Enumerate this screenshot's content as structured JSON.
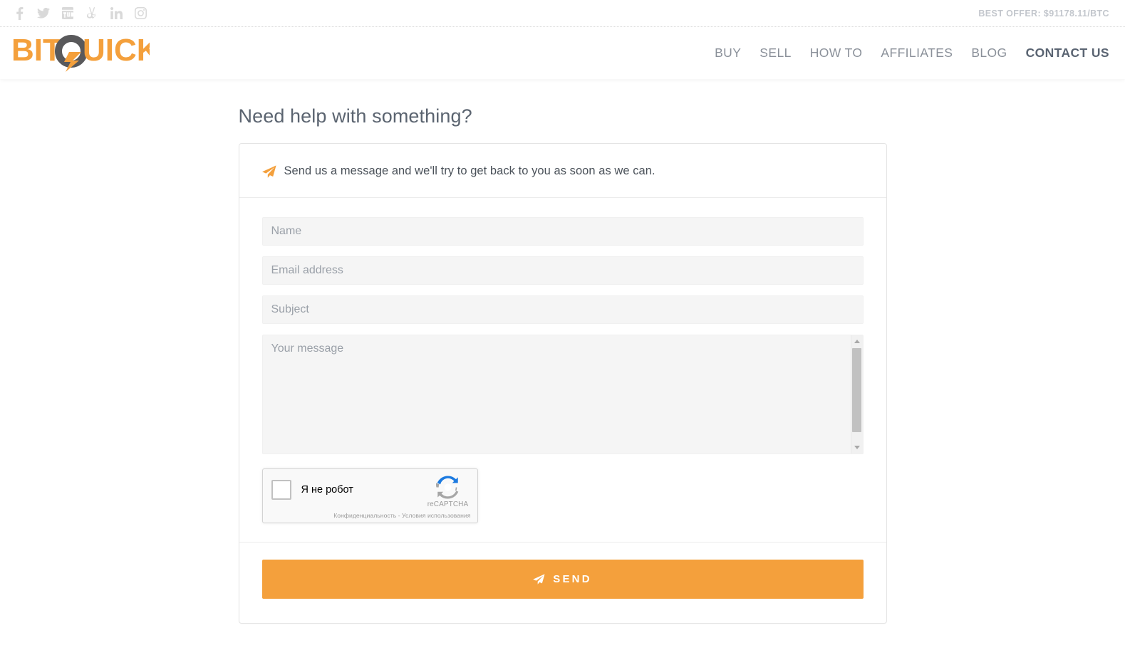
{
  "topbar": {
    "best_offer": "BEST OFFER: $91178.11/BTC",
    "social": [
      {
        "name": "facebook-icon",
        "label": "Facebook"
      },
      {
        "name": "twitter-icon",
        "label": "Twitter"
      },
      {
        "name": "youtube-icon",
        "label": "YouTube"
      },
      {
        "name": "angellist-icon",
        "label": "AngelList"
      },
      {
        "name": "linkedin-icon",
        "label": "LinkedIn"
      },
      {
        "name": "instagram-icon",
        "label": "Instagram"
      }
    ]
  },
  "header": {
    "logo_text_1": "BIT",
    "logo_text_2": "UICK",
    "logo_letter_q": "Q",
    "logo_alt": "BitQuick",
    "nav": [
      {
        "label": "BUY",
        "active": false
      },
      {
        "label": "SELL",
        "active": false
      },
      {
        "label": "HOW TO",
        "active": false
      },
      {
        "label": "AFFILIATES",
        "active": false
      },
      {
        "label": "BLOG",
        "active": false
      },
      {
        "label": "CONTACT US",
        "active": true
      }
    ]
  },
  "main": {
    "page_title": "Need help with something?",
    "card": {
      "intro": "Send us a message and we'll try to get back to you as soon as we can.",
      "fields": {
        "name_placeholder": "Name",
        "name_value": "",
        "email_placeholder": "Email address",
        "email_value": "",
        "subject_placeholder": "Subject",
        "subject_value": "",
        "message_placeholder": "Your message",
        "message_value": ""
      },
      "recaptcha": {
        "checkbox_label": "Я не робот",
        "brand": "reCAPTCHA",
        "legal": "Конфиденциальность - Условия использования",
        "checked": false
      },
      "send_label": "SEND"
    }
  },
  "colors": {
    "brand_orange": "#f4a03c",
    "logo_dark": "#59595b",
    "nav_text": "#8a9099",
    "nav_active": "#5a6472",
    "title_text": "#5b6470",
    "field_bg": "#f5f5f5",
    "placeholder": "#9aa0a8",
    "best_offer_text": "#c2c6cc",
    "recaptcha_blue": "#2079d4",
    "page_bg": "#ffffff"
  }
}
